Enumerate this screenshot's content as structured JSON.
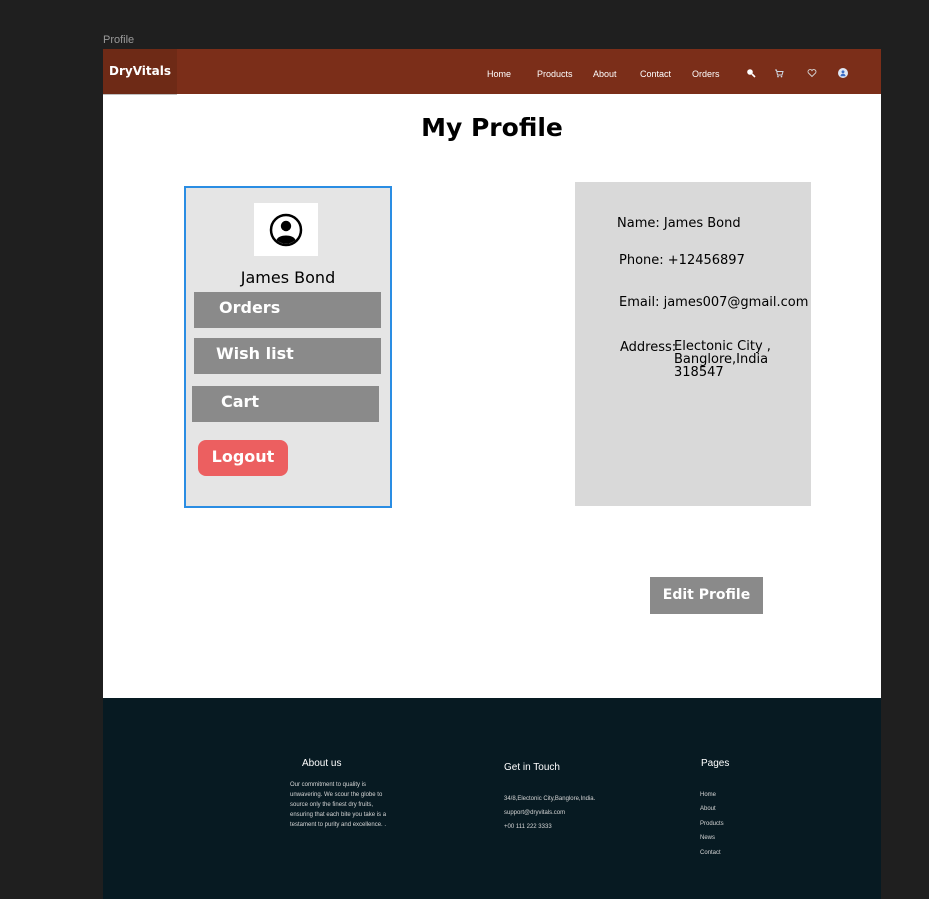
{
  "frame_label": "Profile",
  "navbar": {
    "logo": "DryVitals",
    "links": [
      "Home",
      "Products",
      "About",
      "Contact",
      "Orders"
    ],
    "icons": [
      "search-icon",
      "cart-icon",
      "heart-icon",
      "user-icon"
    ],
    "bg_color": "#7b2e19"
  },
  "page": {
    "title": "My Profile"
  },
  "side_menu": {
    "user_name": "James Bond",
    "items": [
      "Orders",
      "Wish list",
      "Cart"
    ],
    "logout": "Logout",
    "logout_color": "#ec5f60"
  },
  "profile": {
    "name": "Name: James Bond",
    "phone": "Phone: +12456897",
    "email": "Email: james007@gmail.com",
    "address_label": "Address:",
    "address_lines": [
      "Electonic City ,",
      "Banglore,India",
      "318547"
    ]
  },
  "edit_button": "Edit Profile",
  "footer": {
    "about_heading": "About us",
    "about_text": [
      "Our commitment to quality is",
      "unwavering. We scour the globe to",
      "source only the finest dry fruits,",
      "ensuring that each bite you take is a",
      "testament to purity and excellence. ."
    ],
    "touch_heading": "Get in Touch",
    "touch_lines": [
      "34/8,Electonic City,Banglore,India.",
      "support@dryvitals.com",
      "+00 111 222 3333"
    ],
    "pages_heading": "Pages",
    "pages_links": [
      "Home",
      "About",
      "Products",
      "News",
      "Contact"
    ],
    "bg_color": "#071a22"
  }
}
